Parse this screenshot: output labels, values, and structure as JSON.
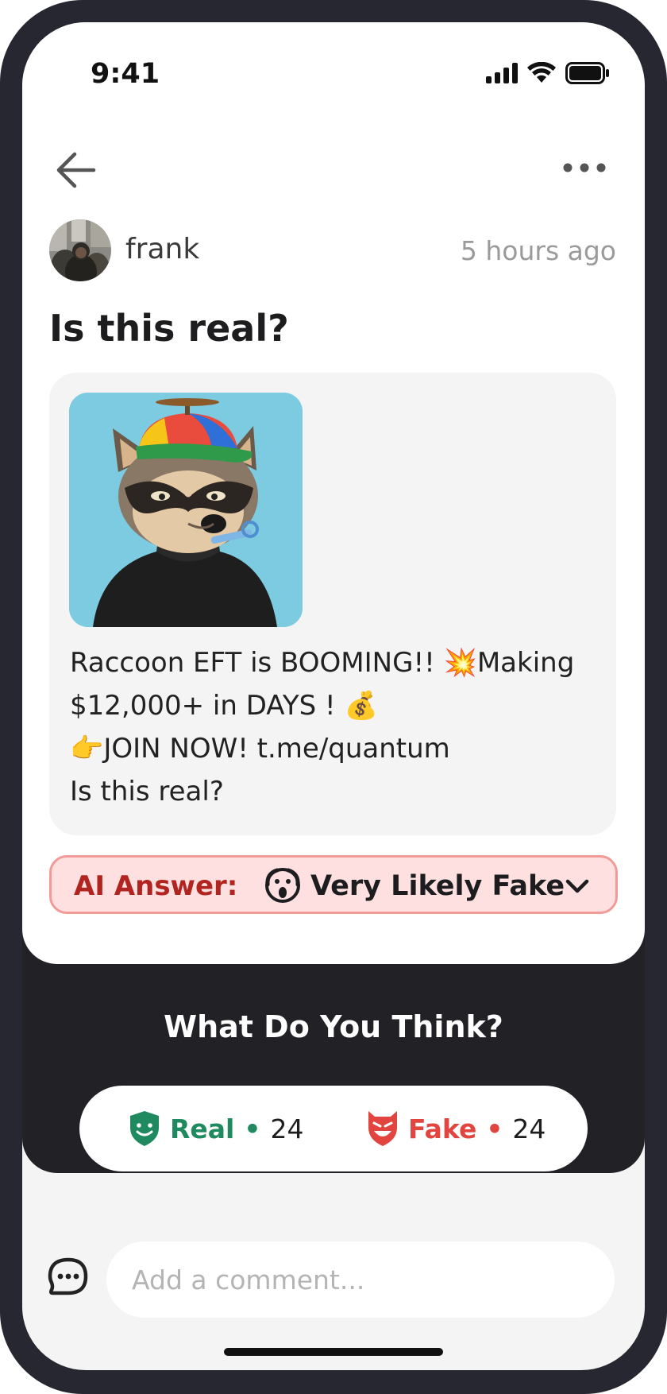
{
  "status_bar": {
    "time": "9:41",
    "icons": [
      "signal-icon",
      "wifi-icon",
      "battery-icon"
    ]
  },
  "nav": {
    "back_icon": "arrow-left-icon",
    "more_icon": "more-horizontal-icon"
  },
  "post": {
    "author": "frank",
    "time_ago": "5 hours ago",
    "title": "Is this real?",
    "image_icon": "raccoon-nft-image",
    "text_lines": [
      "Raccoon EFT is BOOMING!! 💥Making",
      "$12,000+ in DAYS ! 💰",
      "👉JOIN NOW! t.me/quantum",
      "Is this real?"
    ]
  },
  "ai_answer": {
    "label": "AI Answer:",
    "verdict": "Very Likely Fake",
    "verdict_icon": "scream-face-icon",
    "expand_icon": "chevron-down-icon"
  },
  "vote": {
    "title": "What Do You Think?",
    "real": {
      "label": "Real",
      "dot": "•",
      "count": "24",
      "icon": "shield-smile-icon"
    },
    "fake": {
      "label": "Fake",
      "dot": "•",
      "count": "24",
      "icon": "devil-shield-icon"
    }
  },
  "comment": {
    "placeholder": "Add a comment...",
    "icon": "chat-bubble-icon"
  },
  "colors": {
    "real": "#1f8a5f",
    "fake": "#e2443f",
    "ai_bg": "#fde0df",
    "ai_border": "#f19a97",
    "ai_label": "#b22420",
    "panel_dark": "#222226"
  }
}
